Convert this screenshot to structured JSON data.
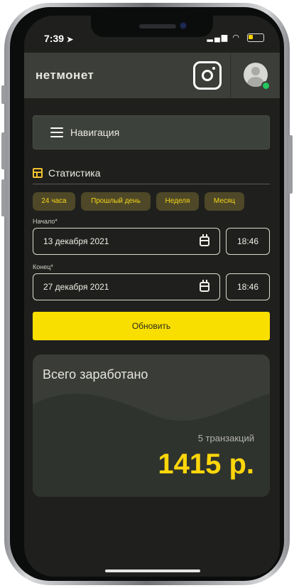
{
  "status_bar": {
    "time": "7:39",
    "signal_icon": "signal-icon",
    "wifi_icon": "wifi-icon",
    "battery_icon": "battery-icon"
  },
  "header": {
    "logo": "нетмонет",
    "instagram_icon": "instagram-icon",
    "avatar_icon": "avatar-icon",
    "online_color": "#22c55e"
  },
  "navigation": {
    "label": "Навигация",
    "icon": "hamburger-icon"
  },
  "statistics": {
    "title": "Статистика",
    "icon": "table-icon",
    "periods": [
      "24 часа",
      "Прошлый день",
      "Неделя",
      "Месяц"
    ],
    "start": {
      "label": "Начало*",
      "date": "13 декабря 2021",
      "time": "18:46"
    },
    "end": {
      "label": "Конец*",
      "date": "27 декабря 2021",
      "time": "18:46"
    },
    "update_label": "Обновить",
    "accent_color": "#f9df00"
  },
  "summary": {
    "title": "Всего заработано",
    "transactions": "5 транзакций",
    "total": "1415 р."
  }
}
